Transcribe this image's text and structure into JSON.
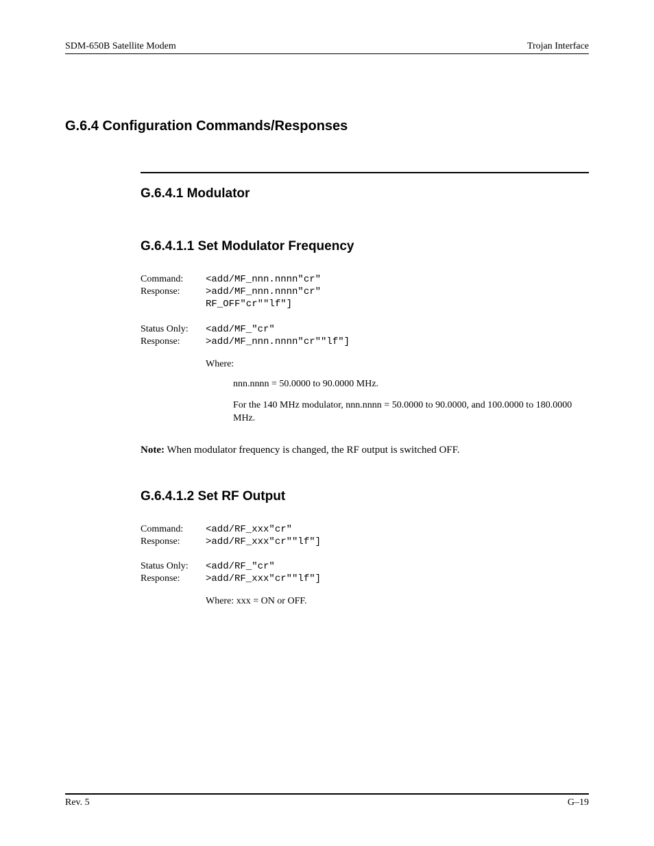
{
  "header": {
    "left": "SDM-650B Satellite Modem",
    "right": "Trojan Interface"
  },
  "sections": {
    "g64": "G.6.4  Configuration Commands/Responses",
    "g641": "G.6.4.1  Modulator",
    "g6411": {
      "title": "G.6.4.1.1  Set Modulator Frequency",
      "command_label": "Command:",
      "command_value": "<add/MF_nnn.nnnn\"cr\"",
      "response_label": "Response:",
      "response_value1": ">add/MF_nnn.nnnn\"cr\"",
      "response_value2": "RF_OFF\"cr\"\"lf\"]",
      "status_label": "Status Only:",
      "status_value": "<add/MF_\"cr\"",
      "status_response_label": "Response:",
      "status_response_value": ">add/MF_nnn.nnnn\"cr\"\"lf\"]",
      "where_label": "Where:",
      "where_detail1": "nnn.nnnn  = 50.0000 to 90.0000 MHz.",
      "where_detail2": "For the 140 MHz modulator, nnn.nnnn = 50.0000 to 90.0000, and 100.0000 to 180.0000 MHz.",
      "note_prefix": "Note:",
      "note_body": " When modulator frequency is changed, the RF output is switched OFF."
    },
    "g6412": {
      "title": "G.6.4.1.2  Set RF Output",
      "command_label": "Command:",
      "command_value": "<add/RF_xxx\"cr\"",
      "response_label": "Response:",
      "response_value": ">add/RF_xxx\"cr\"\"lf\"]",
      "status_label": "Status Only:",
      "status_value": "<add/RF_\"cr\"",
      "status_response_label": "Response:",
      "status_response_value": ">add/RF_xxx\"cr\"\"lf\"]",
      "where_text": "Where: xxx = ON or OFF."
    }
  },
  "footer": {
    "left": "Rev. 5",
    "right": "G–19"
  }
}
